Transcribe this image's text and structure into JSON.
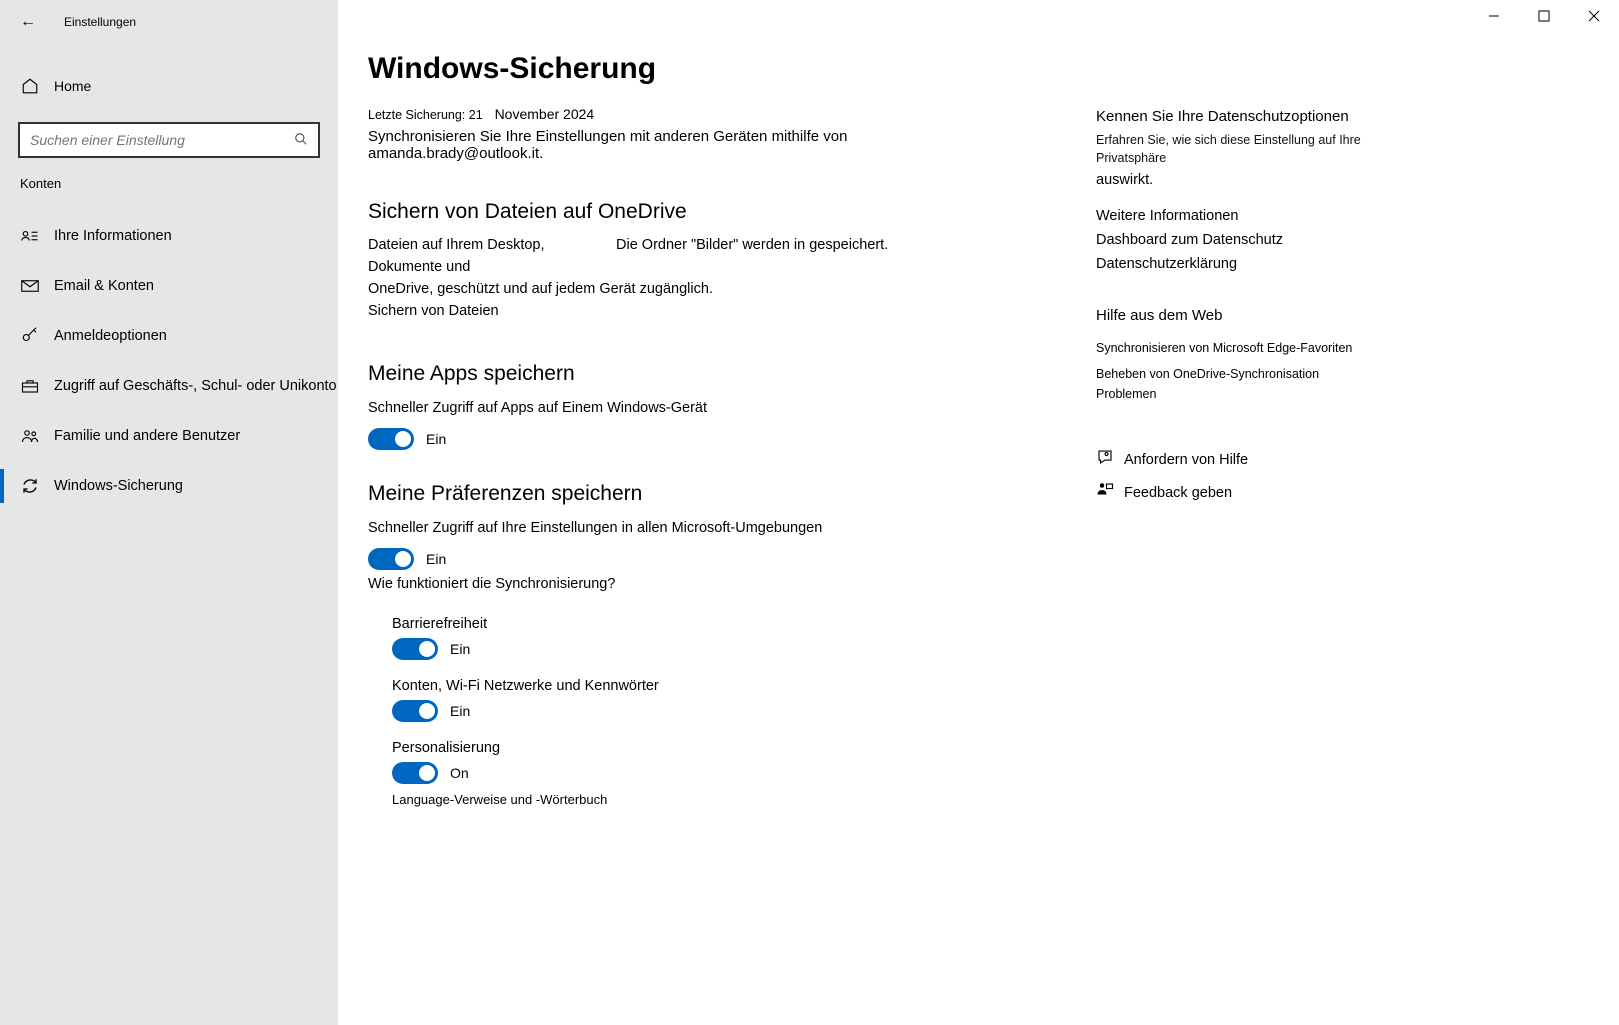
{
  "window": {
    "title": "Einstellungen"
  },
  "search": {
    "placeholder": "Suchen einer Einstellung"
  },
  "sidebar": {
    "home": "Home",
    "category": "Konten",
    "items": [
      {
        "label": "Ihre Informationen"
      },
      {
        "label": "Email &amp; Konten"
      },
      {
        "label": "Anmeldeoptionen"
      },
      {
        "label": "Zugriff auf Geschäfts-, Schul- oder Unikonto"
      },
      {
        "label": "Familie und andere Benutzer"
      },
      {
        "label": "Windows-Sicherung"
      }
    ]
  },
  "page": {
    "title": "Windows-Sicherung",
    "last_backup_prefix": "Letzte Sicherung: 21",
    "last_backup_date": "November 2024",
    "sync_line": "Synchronisieren Sie Ihre Einstellungen mit anderen Geräten mithilfe von amanda.brady@outlook.it.",
    "onedrive": {
      "heading": "Sichern von Dateien auf OneDrive",
      "left": "Dateien auf Ihrem Desktop, Dokumente und",
      "right": "Die Ordner \"Bilder\" werden in gespeichert.",
      "line2": "OneDrive, geschützt und auf jedem Gerät zugänglich.",
      "link": "Sichern von Dateien"
    },
    "apps": {
      "heading": "Meine Apps speichern",
      "desc": "Schneller Zugriff auf Apps auf Einem Windows-Gerät",
      "state": "Ein"
    },
    "prefs": {
      "heading": "Meine Präferenzen speichern",
      "desc": "Schneller Zugriff auf Ihre Einstellungen in allen Microsoft-Umgebungen",
      "state": "Ein",
      "how": "Wie funktioniert die Synchronisierung?",
      "items": [
        {
          "label": "Barrierefreiheit",
          "state": "Ein"
        },
        {
          "label": "Konten, Wi-Fi Netzwerke und Kennwörter",
          "state": "Ein"
        },
        {
          "label": "Personalisierung",
          "state": "On"
        }
      ],
      "last": "Language-Verweise und -Wörterbuch"
    }
  },
  "info": {
    "privacy_h": "Kennen Sie Ihre Datenschutzoptionen",
    "privacy_l1": "Erfahren Sie, wie sich diese Einstellung auf Ihre Privatsphäre",
    "privacy_l2": "auswirkt.",
    "more": "Weitere Informationen",
    "dashboard": "Dashboard zum Datenschutz",
    "decl": "Datenschutzerklärung",
    "web_h": "Hilfe aus dem Web",
    "web_l1": "Synchronisieren von Microsoft Edge-Favoriten",
    "web_l2": "Beheben von OneDrive-Synchronisation Problemen",
    "help": "Anfordern von Hilfe",
    "feedback": "Feedback geben"
  }
}
